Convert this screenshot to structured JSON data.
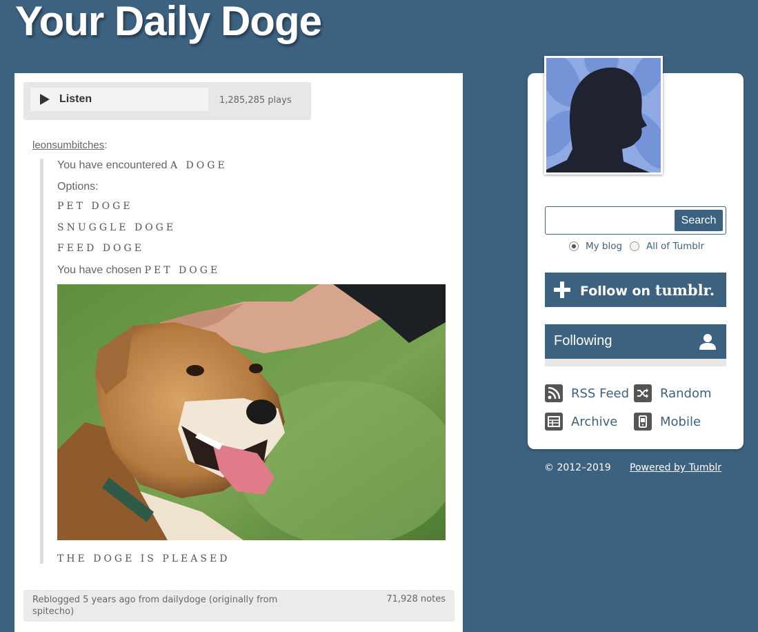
{
  "blog": {
    "title": "Your Daily Doge"
  },
  "colors": {
    "background": "#3d6280",
    "accent": "#3d6280",
    "card": "#ffffff"
  },
  "audio": {
    "listen_label": "Listen",
    "plays": "1,285,285 plays",
    "icon": "play-icon"
  },
  "post": {
    "reblogged_user": "leonsumbitches",
    "reblogged_sep": ":",
    "lines": {
      "encounter_prefix": "You have encountered ",
      "encounter_value": "A DOGE",
      "options_label": "Options:",
      "option_1": "PET DOGE",
      "option_2": "SNUGGLE DOGE",
      "option_3": "FEED DOGE",
      "chosen_prefix": "You have chosen ",
      "chosen_value": "PET DOGE",
      "result": "THE DOGE IS PLEASED"
    },
    "footer": {
      "reblog_info": "Reblogged 5 years ago from dailydoge (originally from spitecho)",
      "notes": "71,928 notes"
    }
  },
  "sidebar": {
    "search": {
      "placeholder": "",
      "button_label": "Search"
    },
    "scope_options": [
      {
        "label": "My blog",
        "selected": true
      },
      {
        "label": "All of Tumblr",
        "selected": false
      }
    ],
    "follow": {
      "label": "Follow on ",
      "brand": "tumblr."
    },
    "following": {
      "label": "Following"
    },
    "links": [
      {
        "label": "RSS Feed",
        "icon": "rss-icon"
      },
      {
        "label": "Random",
        "icon": "shuffle-icon"
      },
      {
        "label": "Archive",
        "icon": "archive-icon"
      },
      {
        "label": "Mobile",
        "icon": "mobile-icon"
      }
    ]
  },
  "footer": {
    "copyright": "© 2012–2019",
    "powered": "Powered by Tumblr"
  }
}
